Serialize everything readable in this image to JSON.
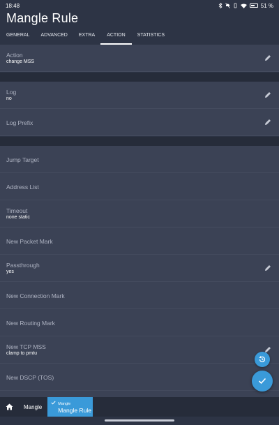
{
  "status": {
    "time": "18:48",
    "battery": "51 %"
  },
  "title": "Mangle Rule",
  "tabs": [
    "GENERAL",
    "ADVANCED",
    "EXTRA",
    "ACTION",
    "STATISTICS"
  ],
  "active_tab": "ACTION",
  "fields": {
    "action": {
      "label": "Action",
      "value": "change MSS"
    },
    "log": {
      "label": "Log",
      "value": "no"
    },
    "log_prefix": {
      "label": "Log Prefix"
    },
    "jump_target": {
      "label": "Jump Target"
    },
    "address_list": {
      "label": "Address List"
    },
    "timeout": {
      "label": "Timeout",
      "value": "none static"
    },
    "new_packet_mark": {
      "label": "New Packet Mark"
    },
    "passthrough": {
      "label": "Passthrough",
      "value": "yes"
    },
    "new_connection_mark": {
      "label": "New Connection Mark"
    },
    "new_routing_mark": {
      "label": "New Routing Mark"
    },
    "new_tcp_mss": {
      "label": "New TCP MSS",
      "value": "clamp to pmtu"
    },
    "new_dscp": {
      "label": "New DSCP (TOS)"
    }
  },
  "breadcrumb": {
    "parent": "Mangle",
    "current_small": "Mangle",
    "current": "Mangle Rule"
  },
  "colors": {
    "accent": "#3a9ad9",
    "background": "#2d3445",
    "row": "#3b4255"
  }
}
